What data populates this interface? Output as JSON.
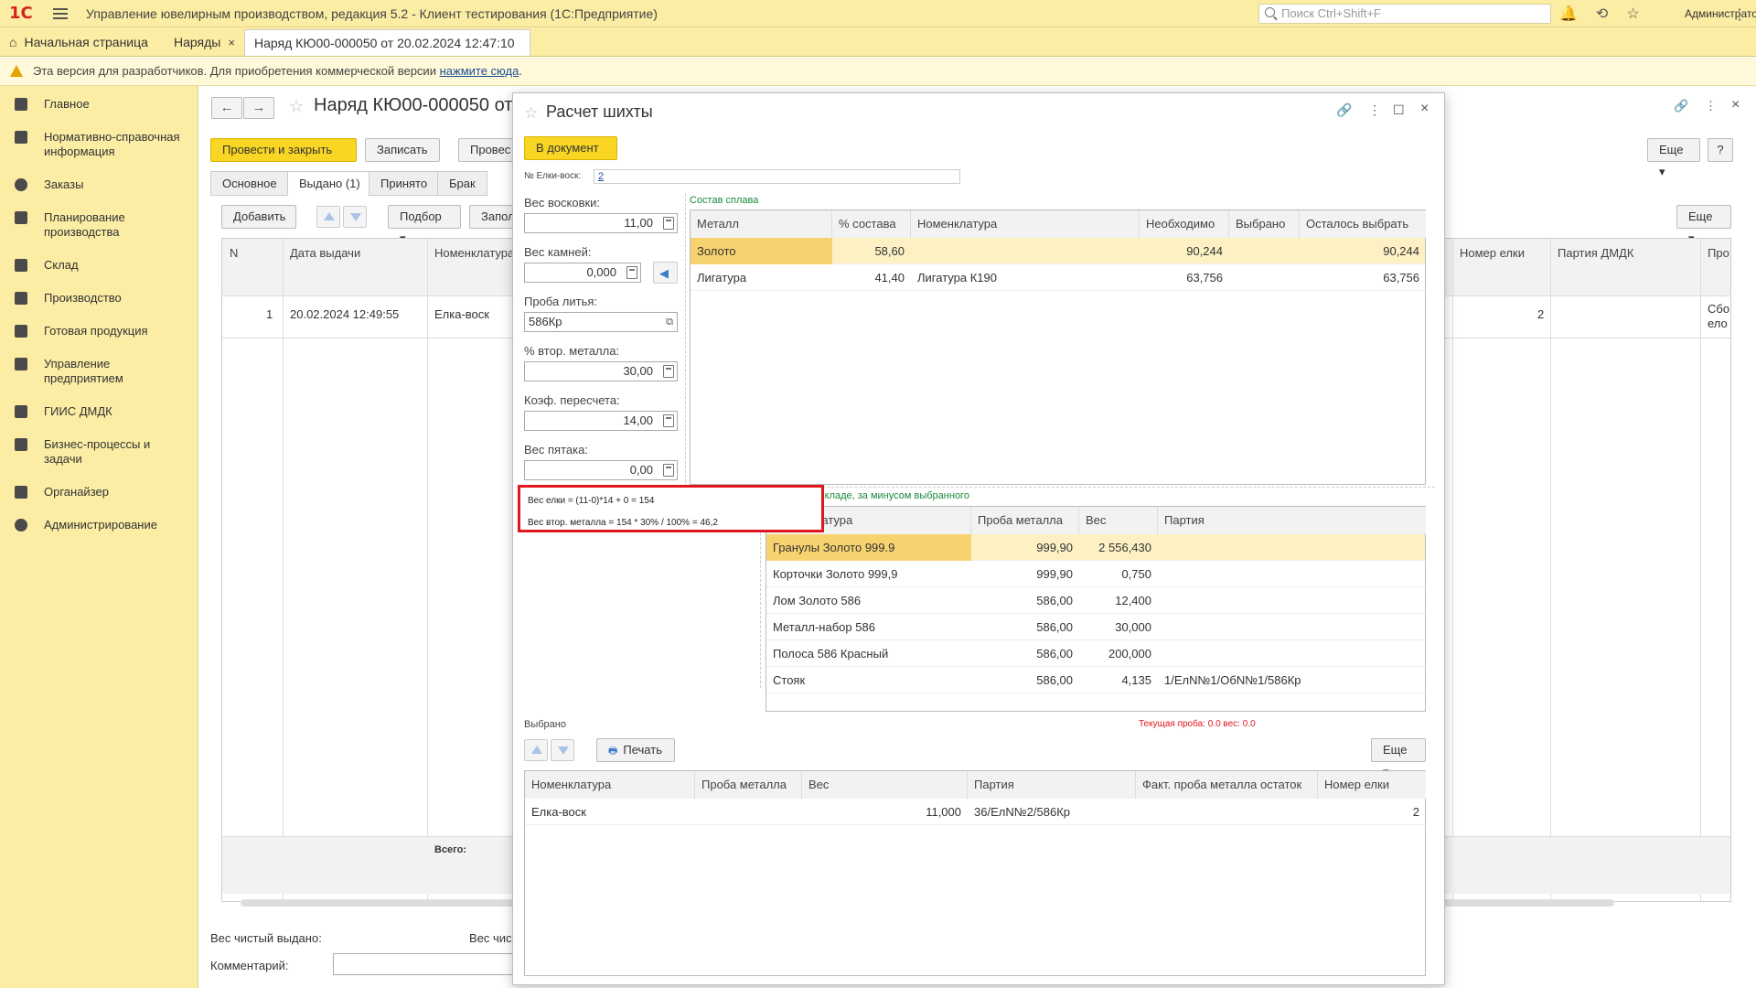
{
  "app": {
    "logo": "1С",
    "title": "Управление ювелирным производством, редакция 5.2  -  Клиент тестирования (1С:Предприятие)",
    "search_placeholder": "Поиск Ctrl+Shift+F",
    "user": "Администратор"
  },
  "tabs": [
    {
      "label": "Начальная страница"
    },
    {
      "label": "Наряды"
    },
    {
      "label": "Наряд КЮ00-000050 от 20.02.2024 12:47:10 *"
    }
  ],
  "warning": {
    "text": "Эта версия для разработчиков. Для приобретения коммерческой версии",
    "link": "нажмите сюда",
    "tail": "."
  },
  "sidebar": {
    "items": [
      {
        "label": "Главное",
        "icon": "crown-icon"
      },
      {
        "label": "Нормативно-справочная информация",
        "icon": "book-icon"
      },
      {
        "label": "Заказы",
        "icon": "pie-chart-icon"
      },
      {
        "label": "Планирование производства",
        "icon": "clipboard-icon"
      },
      {
        "label": "Склад",
        "icon": "grid-icon"
      },
      {
        "label": "Производство",
        "icon": "factory-icon"
      },
      {
        "label": "Готовая продукция",
        "icon": "bag-icon"
      },
      {
        "label": "Управление предприятием",
        "icon": "org-icon"
      },
      {
        "label": "ГИИС ДМДК",
        "icon": "link-icon"
      },
      {
        "label": "Бизнес-процессы и задачи",
        "icon": "tasks-icon"
      },
      {
        "label": "Органайзер",
        "icon": "sliders-icon"
      },
      {
        "label": "Администрирование",
        "icon": "gear-icon"
      }
    ]
  },
  "doc": {
    "title": "Наряд КЮ00-000050 от 2",
    "btn_post_close": "Провести и закрыть",
    "btn_save": "Записать",
    "btn_post": "Провес",
    "subtabs": [
      "Основное",
      "Выдано (1)",
      "Принято",
      "Брак"
    ],
    "btn_add": "Добавить",
    "btn_pick": "Подбор",
    "btn_fill": "Запол",
    "btn_more": "Еще",
    "btn_more2": "Еще",
    "btn_help": "?",
    "grid_headers": [
      "N",
      "Дата выдачи",
      "Номенклатура",
      "Номер елки",
      "Партия ДМДК",
      "Про"
    ],
    "row": {
      "n": "1",
      "date": "20.02.2024 12:49:55",
      "nom": "Елка-воск",
      "tree": "2",
      "extra": "Сбо",
      "extra2": "ело"
    },
    "total_label": "Всего:",
    "net_weight_label": "Вес чистый выдано:",
    "net_weight_label2": "Вес чис",
    "comment_label": "Комментарий:"
  },
  "dialog": {
    "title": "Расчет шихты",
    "btn_to_doc": "В документ",
    "tree_label": "№ Елки-воск:",
    "tree_value": "2",
    "fields": {
      "wax_weight_label": "Вес восковки:",
      "wax_weight": "11,00",
      "stones_label": "Вес камней:",
      "stones": "0,000",
      "cast_label": "Проба литья:",
      "cast": "586Кр",
      "sec_metal_label": "% втор. металла:",
      "sec_metal": "30,00",
      "coef_label": "Коэф. пересчета:",
      "coef": "14,00",
      "nickel_label": "Вес пятака:",
      "nickel": "0,00"
    },
    "formula": {
      "line1": "Вес елки = (11-0)*14 + 0 = 154",
      "line2": "Вес втор. металла = 154 * 30% / 100% = 46,2"
    },
    "alloy": {
      "caption": "Состав сплава",
      "headers": [
        "Металл",
        "% состава",
        "Номенклатура",
        "Необходимо",
        "Выбрано",
        "Осталось выбрать"
      ],
      "rows": [
        [
          "Золото",
          "58,60",
          "",
          "90,244",
          "",
          "90,244"
        ],
        [
          "Лигатура",
          "41,40",
          "Лигатура К190",
          "63,756",
          "",
          "63,756"
        ]
      ]
    },
    "stock": {
      "caption": "Остатки на складе, за минусом выбранного",
      "headers": [
        "Номенклатура",
        "Проба металла",
        "Вес",
        "Партия"
      ],
      "rows": [
        [
          "Гранулы Золото 999.9",
          "999,90",
          "2 556,430",
          ""
        ],
        [
          "Корточки Золото 999,9",
          "999,90",
          "0,750",
          ""
        ],
        [
          "Лом Золото  586",
          "586,00",
          "12,400",
          ""
        ],
        [
          "Металл-набор 586",
          "586,00",
          "30,000",
          ""
        ],
        [
          "Полоса 586 Красный",
          "586,00",
          "200,000",
          ""
        ],
        [
          "Стояк",
          "586,00",
          "4,135",
          "1/ЕлN№1/ОбN№1/586Кр"
        ]
      ]
    },
    "current_probe": "Текущая проба: 0.0 вес: 0.0",
    "selected": {
      "caption": "Выбрано",
      "btn_print": "Печать",
      "btn_more": "Еще",
      "headers": [
        "Номенклатура",
        "Проба металла",
        "Вес",
        "Партия",
        "Факт. проба металла остаток",
        "Номер елки"
      ],
      "rows": [
        [
          "Елка-воск",
          "",
          "11,000",
          "36/ЕлN№2/586Кр",
          "",
          "2"
        ]
      ]
    }
  },
  "colors": {
    "accent_yellow": "#f9d623",
    "panel_yellow": "#fbeda4",
    "highlight_red": "#e0171e",
    "caption_green": "#1a8a3a"
  }
}
